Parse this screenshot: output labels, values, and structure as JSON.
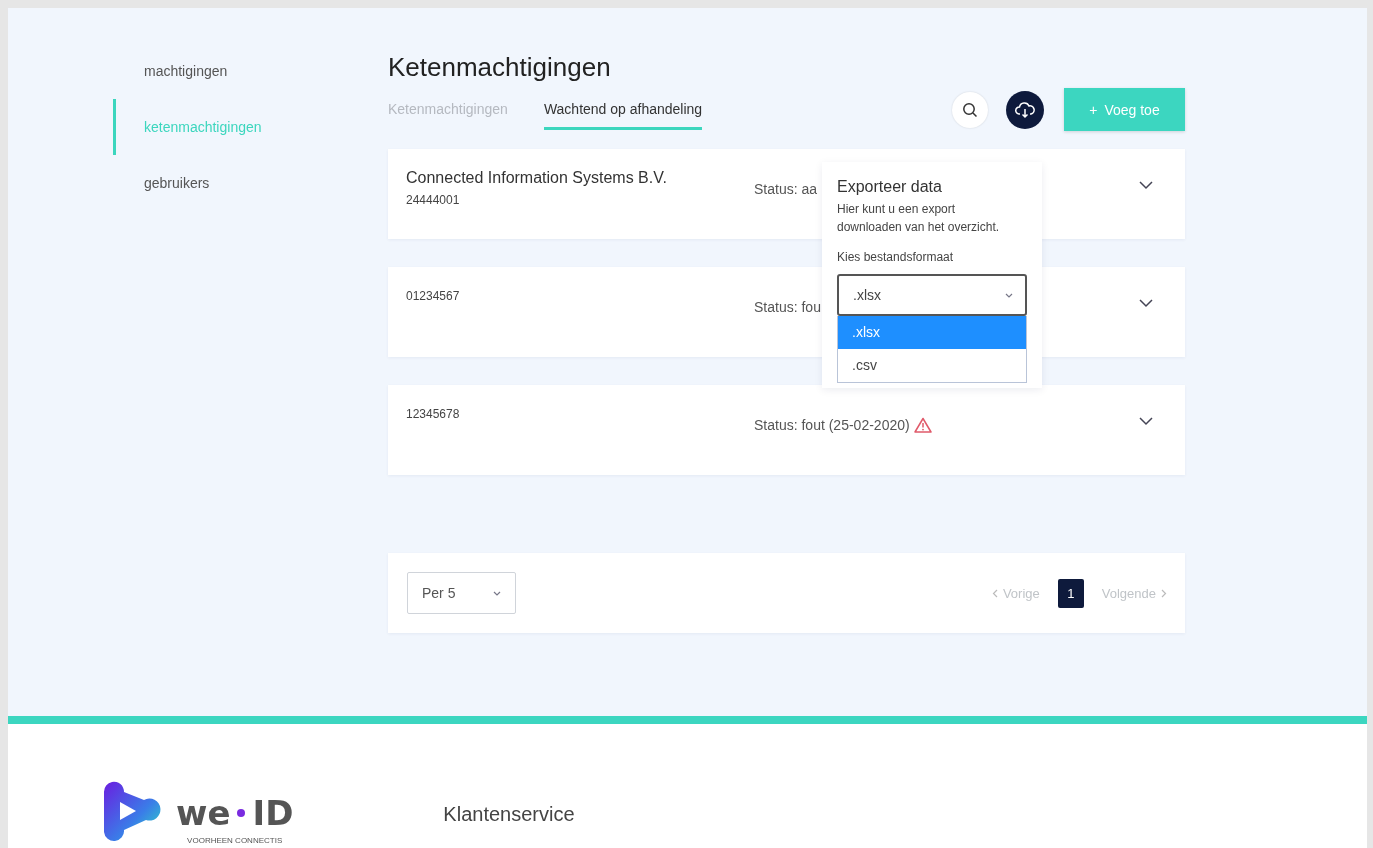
{
  "sidebar": {
    "items": [
      {
        "label": "machtigingen",
        "selected": false
      },
      {
        "label": "ketenmachtigingen",
        "selected": true
      },
      {
        "label": "gebruikers",
        "selected": false
      }
    ]
  },
  "title": "Ketenmachtigingen",
  "tabs": [
    {
      "label": "Ketenmachtigingen",
      "selected": false
    },
    {
      "label": "Wachtend op afhandeling",
      "selected": true
    }
  ],
  "add_button": {
    "icon": "+",
    "label": "Voeg toe"
  },
  "rows": [
    {
      "name": "Connected Information Systems B.V.",
      "number": "24444001",
      "status": "Status: aa"
    },
    {
      "number": "01234567",
      "status": "Status: fou"
    },
    {
      "number": "12345678",
      "status": "Status: fout (25-02-2020)",
      "warning": true
    }
  ],
  "export_popup": {
    "title": "Exporteer data",
    "description": "Hier kunt u een export downloaden van het overzicht.",
    "format_label": "Kies bestandsformaat",
    "value": ".xlsx",
    "options": [
      {
        "label": ".xlsx",
        "selected": true
      },
      {
        "label": ".csv",
        "selected": false
      }
    ]
  },
  "pagination": {
    "per_page": "Per 5",
    "previous": "Vorige",
    "pages": [
      {
        "label": "1",
        "selected": true
      }
    ],
    "next": "Volgende"
  },
  "footer": {
    "logo": {
      "word_1": "we",
      "word_2": "ID",
      "tagline": "VOORHEEN CONNECTIS"
    },
    "links": [
      "Klantenservice"
    ]
  }
}
